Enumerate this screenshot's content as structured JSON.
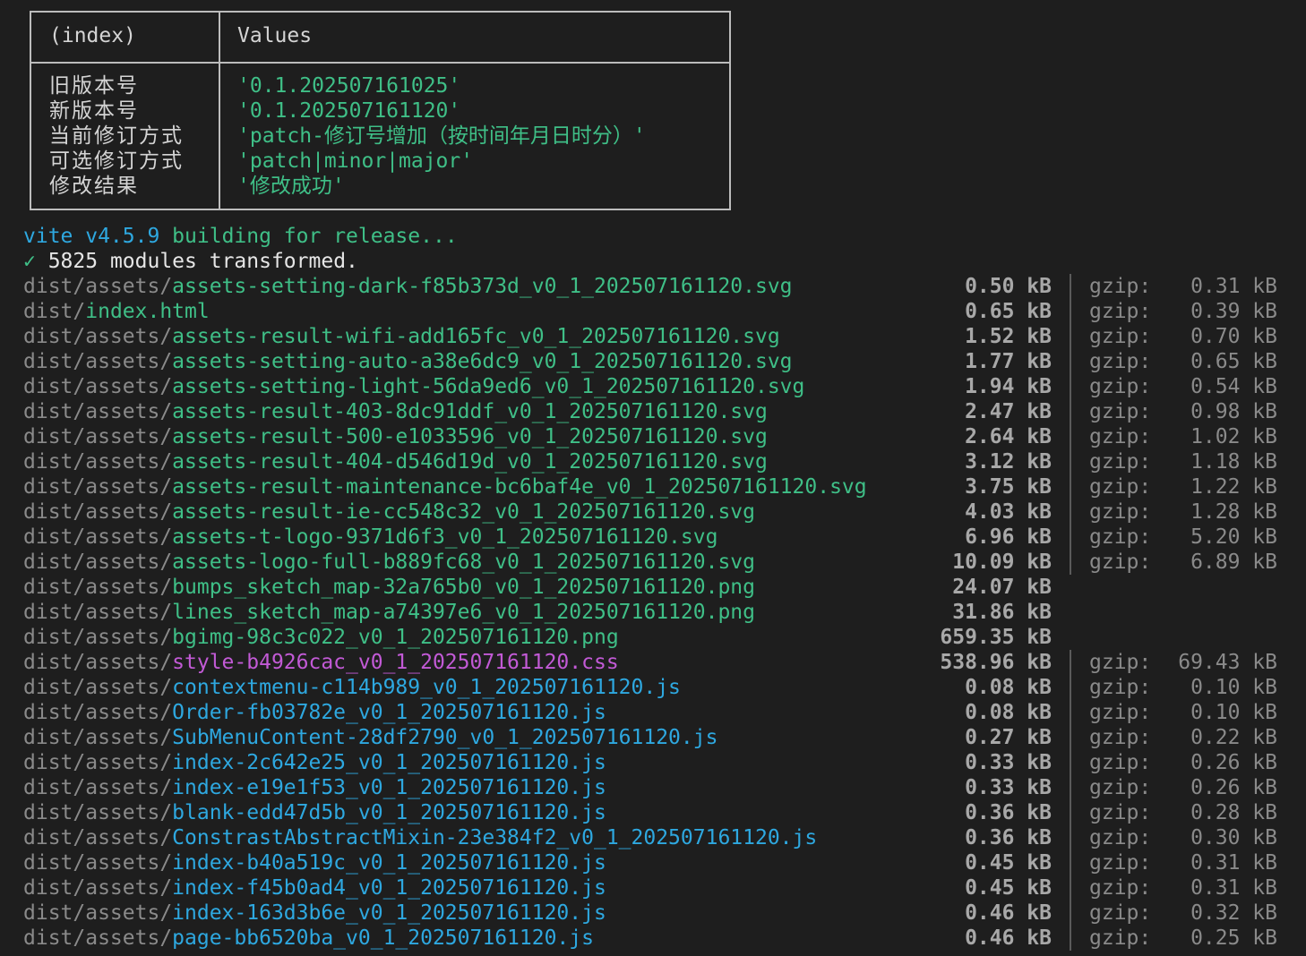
{
  "table": {
    "headers": [
      "(index)",
      "Values"
    ],
    "rows": [
      {
        "key": "旧版本号",
        "value": "'0.1.202507161025'"
      },
      {
        "key": "新版本号",
        "value": "'0.1.202507161120'"
      },
      {
        "key": "当前修订方式",
        "value": "'patch-修订号增加（按时间年月日时分）'"
      },
      {
        "key": "可选修订方式",
        "value": "'patch|minor|major'"
      },
      {
        "key": "修改结果",
        "value": "'修改成功'"
      }
    ]
  },
  "build": {
    "vite_version": "vite v4.5.9",
    "building_text": " building for release...",
    "check_mark": "✓",
    "modules_text": " 5825 modules transformed."
  },
  "files": [
    {
      "dir": "dist/assets/",
      "name": "assets-setting-dark-f85b373d_v0_1_202507161120.svg",
      "kind": "green",
      "size": "0.50 kB",
      "gzip_label": "gzip:",
      "gzip": "0.31 kB"
    },
    {
      "dir": "dist/",
      "name": "index.html",
      "kind": "green",
      "size": "0.65 kB",
      "gzip_label": "gzip:",
      "gzip": "0.39 kB"
    },
    {
      "dir": "dist/assets/",
      "name": "assets-result-wifi-add165fc_v0_1_202507161120.svg",
      "kind": "green",
      "size": "1.52 kB",
      "gzip_label": "gzip:",
      "gzip": "0.70 kB"
    },
    {
      "dir": "dist/assets/",
      "name": "assets-setting-auto-a38e6dc9_v0_1_202507161120.svg",
      "kind": "green",
      "size": "1.77 kB",
      "gzip_label": "gzip:",
      "gzip": "0.65 kB"
    },
    {
      "dir": "dist/assets/",
      "name": "assets-setting-light-56da9ed6_v0_1_202507161120.svg",
      "kind": "green",
      "size": "1.94 kB",
      "gzip_label": "gzip:",
      "gzip": "0.54 kB"
    },
    {
      "dir": "dist/assets/",
      "name": "assets-result-403-8dc91ddf_v0_1_202507161120.svg",
      "kind": "green",
      "size": "2.47 kB",
      "gzip_label": "gzip:",
      "gzip": "0.98 kB"
    },
    {
      "dir": "dist/assets/",
      "name": "assets-result-500-e1033596_v0_1_202507161120.svg",
      "kind": "green",
      "size": "2.64 kB",
      "gzip_label": "gzip:",
      "gzip": "1.02 kB"
    },
    {
      "dir": "dist/assets/",
      "name": "assets-result-404-d546d19d_v0_1_202507161120.svg",
      "kind": "green",
      "size": "3.12 kB",
      "gzip_label": "gzip:",
      "gzip": "1.18 kB"
    },
    {
      "dir": "dist/assets/",
      "name": "assets-result-maintenance-bc6baf4e_v0_1_202507161120.svg",
      "kind": "green",
      "size": "3.75 kB",
      "gzip_label": "gzip:",
      "gzip": "1.22 kB"
    },
    {
      "dir": "dist/assets/",
      "name": "assets-result-ie-cc548c32_v0_1_202507161120.svg",
      "kind": "green",
      "size": "4.03 kB",
      "gzip_label": "gzip:",
      "gzip": "1.28 kB"
    },
    {
      "dir": "dist/assets/",
      "name": "assets-t-logo-9371d6f3_v0_1_202507161120.svg",
      "kind": "green",
      "size": "6.96 kB",
      "gzip_label": "gzip:",
      "gzip": "5.20 kB"
    },
    {
      "dir": "dist/assets/",
      "name": "assets-logo-full-b889fc68_v0_1_202507161120.svg",
      "kind": "green",
      "size": "10.09 kB",
      "gzip_label": "gzip:",
      "gzip": "6.89 kB"
    },
    {
      "dir": "dist/assets/",
      "name": "bumps_sketch_map-32a765b0_v0_1_202507161120.png",
      "kind": "green",
      "size": "24.07 kB"
    },
    {
      "dir": "dist/assets/",
      "name": "lines_sketch_map-a74397e6_v0_1_202507161120.png",
      "kind": "green",
      "size": "31.86 kB"
    },
    {
      "dir": "dist/assets/",
      "name": "bgimg-98c3c022_v0_1_202507161120.png",
      "kind": "green",
      "size": "659.35 kB"
    },
    {
      "dir": "dist/assets/",
      "name": "style-b4926cac_v0_1_202507161120.css",
      "kind": "magenta",
      "size": "538.96 kB",
      "gzip_label": "gzip:",
      "gzip": "69.43 kB"
    },
    {
      "dir": "dist/assets/",
      "name": "contextmenu-c114b989_v0_1_202507161120.js",
      "kind": "blue",
      "size": "0.08 kB",
      "gzip_label": "gzip:",
      "gzip": "0.10 kB"
    },
    {
      "dir": "dist/assets/",
      "name": "Order-fb03782e_v0_1_202507161120.js",
      "kind": "blue",
      "size": "0.08 kB",
      "gzip_label": "gzip:",
      "gzip": "0.10 kB"
    },
    {
      "dir": "dist/assets/",
      "name": "SubMenuContent-28df2790_v0_1_202507161120.js",
      "kind": "blue",
      "size": "0.27 kB",
      "gzip_label": "gzip:",
      "gzip": "0.22 kB"
    },
    {
      "dir": "dist/assets/",
      "name": "index-2c642e25_v0_1_202507161120.js",
      "kind": "blue",
      "size": "0.33 kB",
      "gzip_label": "gzip:",
      "gzip": "0.26 kB"
    },
    {
      "dir": "dist/assets/",
      "name": "index-e19e1f53_v0_1_202507161120.js",
      "kind": "blue",
      "size": "0.33 kB",
      "gzip_label": "gzip:",
      "gzip": "0.26 kB"
    },
    {
      "dir": "dist/assets/",
      "name": "blank-edd47d5b_v0_1_202507161120.js",
      "kind": "blue",
      "size": "0.36 kB",
      "gzip_label": "gzip:",
      "gzip": "0.28 kB"
    },
    {
      "dir": "dist/assets/",
      "name": "ConstrastAbstractMixin-23e384f2_v0_1_202507161120.js",
      "kind": "blue",
      "size": "0.36 kB",
      "gzip_label": "gzip:",
      "gzip": "0.30 kB"
    },
    {
      "dir": "dist/assets/",
      "name": "index-b40a519c_v0_1_202507161120.js",
      "kind": "blue",
      "size": "0.45 kB",
      "gzip_label": "gzip:",
      "gzip": "0.31 kB"
    },
    {
      "dir": "dist/assets/",
      "name": "index-f45b0ad4_v0_1_202507161120.js",
      "kind": "blue",
      "size": "0.45 kB",
      "gzip_label": "gzip:",
      "gzip": "0.31 kB"
    },
    {
      "dir": "dist/assets/",
      "name": "index-163d3b6e_v0_1_202507161120.js",
      "kind": "blue",
      "size": "0.46 kB",
      "gzip_label": "gzip:",
      "gzip": "0.32 kB"
    },
    {
      "dir": "dist/assets/",
      "name": "page-bb6520ba_v0_1_202507161120.js",
      "kind": "blue",
      "size": "0.46 kB",
      "gzip_label": "gzip:",
      "gzip": "0.25 kB"
    }
  ],
  "colors": {
    "background": "#1e1e1e",
    "green": "#3fbf87",
    "blue": "#2ea8e0",
    "magenta": "#c25ad6",
    "dim": "#8a8a8a"
  }
}
